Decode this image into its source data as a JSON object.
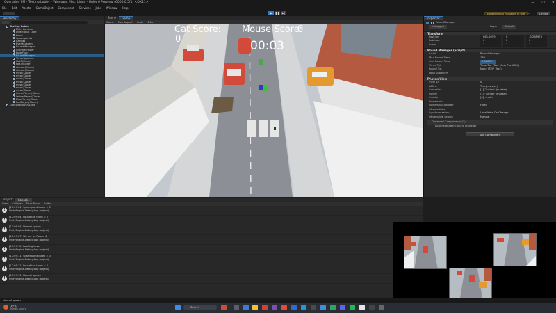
{
  "window": {
    "title": "Operation PM - Testing Lobby - Windows, Mac, Linux - Unity 6 Preview (6000.0.5f1) <DX11>",
    "min": "—",
    "max": "☐",
    "close": "✕"
  },
  "menu": [
    "File",
    "Edit",
    "Assets",
    "GameObject",
    "Component",
    "Services",
    "Jobs",
    "Window",
    "Help"
  ],
  "toolbar": {
    "package": "Experimental Packages In Use",
    "layout": "Layout"
  },
  "hierarchy": {
    "tab": "Hierarchy",
    "items": [
      {
        "label": "Testing Lobby",
        "bold": true
      },
      {
        "label": "Main Camera"
      },
      {
        "label": "Directional Light"
      },
      {
        "label": "Level"
      },
      {
        "label": "Spawnpoints"
      },
      {
        "label": "Canvas"
      },
      {
        "label": "EventSystem"
      },
      {
        "label": "RoundManager"
      },
      {
        "label": "ScoreManager"
      },
      {
        "label": "Fake Floor"
      },
      {
        "label": "RoundManager",
        "sel": true
      },
      {
        "label": "TimerSpawner"
      },
      {
        "label": "Hat3(Clone)"
      },
      {
        "label": "Hat3(Clone)"
      },
      {
        "label": "cheese(Clone)"
      },
      {
        "label": "cheese(Clone)"
      },
      {
        "label": "meat(Clone)"
      },
      {
        "label": "meat(Clone)"
      },
      {
        "label": "meat(Clone)"
      },
      {
        "label": "meat(Clone)"
      },
      {
        "label": "meat(Clone)"
      },
      {
        "label": "meat(Clone)"
      },
      {
        "label": "meat(Clone)"
      },
      {
        "label": "GreenPlayer(Clone)"
      },
      {
        "label": "YellowPlayer(Clone)"
      },
      {
        "label": "BluePlayer(Clone)"
      },
      {
        "label": "RedPlayer(Clone)"
      },
      {
        "label": "DontDestroyOnLoad"
      }
    ]
  },
  "scene_tabs": [
    {
      "label": "Scene"
    },
    {
      "label": "Game",
      "active": true
    }
  ],
  "game_bar": {
    "display": "Game",
    "aspect": "Free Aspect",
    "scale": "Scale",
    "scale_val": "1.1x"
  },
  "hud": {
    "cat_label": "Cat Score:",
    "cat_score": "0",
    "mouse_label": "Mouse Score:",
    "mouse_score": "0",
    "timer": "00:03"
  },
  "inspector": {
    "tab": "Inspector",
    "object": "RoundManager",
    "tag": "Untagged",
    "layer_label": "Layer",
    "layer": "Default",
    "transform": {
      "title": "Transform",
      "rows": [
        {
          "k": "Position",
          "x": "661.2059",
          "y": "0",
          "z": "-3.288973"
        },
        {
          "k": "Rotation",
          "x": "0",
          "y": "0",
          "z": "0"
        },
        {
          "k": "Scale",
          "x": "1",
          "y": "1",
          "z": "1"
        }
      ]
    },
    "round_manager": {
      "title": "Round Manager (Script)",
      "rows": [
        {
          "k": "Script",
          "v": "RoundManager"
        },
        {
          "k": "Max Round Time",
          "v": "180"
        },
        {
          "k": "Curr Round Time",
          "v": "3.338577"
        },
        {
          "k": "Timer Txt",
          "v": "TimerTxt (Text Mesh Pro UGUI)"
        },
        {
          "k": "Round Txt",
          "v": "None (TMP_Text)"
        },
        {
          "k": "Food Spawners",
          "v": ""
        }
      ]
    },
    "photon_view": {
      "title": "Photon View",
      "rows": [
        {
          "k": "View ID",
          "v": "0"
        },
        {
          "k": "IsMine",
          "v": "True (master)"
        },
        {
          "k": "Controller",
          "v": "[1] 'Tuchan' (master)"
        },
        {
          "k": "Owner",
          "v": "[1] 'Tuchan' (master)"
        },
        {
          "k": "Creator",
          "v": "[0] <null>"
        },
        {
          "k": "Ownership",
          "v": ""
        },
        {
          "k": "Ownership Transfer",
          "v": "Fixed"
        },
        {
          "k": "Observables",
          "v": ""
        },
        {
          "k": "Synchronization",
          "v": "Unreliable On Change"
        },
        {
          "k": "Observable Search",
          "v": "Manual"
        }
      ]
    },
    "observed": "Observed Components (1)",
    "observed_item": "RoundManager (Round Manager)",
    "add_component": "Add Component"
  },
  "console": {
    "tabs": [
      "Project",
      "Console"
    ],
    "buttons": [
      "Clear",
      "Collapse",
      "Error Pause",
      "Editor"
    ],
    "logs": [
      {
        "t": "[17:09:04] Spawnpoint index = 0",
        "s": "UnityEngine.Debug:Log (object)"
      },
      {
        "t": "[17:09:04] Found the team = 0",
        "s": "UnityEngine.Debug:Log (object)"
      },
      {
        "t": "[17:09:04] Normal spawn",
        "s": "UnityEngine.Debug:Log (object)"
      },
      {
        "t": "[17:09:07] We are on Round 4",
        "s": "UnityEngine.Debug:Log (object)"
      },
      {
        "t": "[17:09:10] Loading Level",
        "s": "UnityEngine.Debug:Log (object)"
      },
      {
        "t": "[17:09:11] Spawnpoint index = 0",
        "s": "UnityEngine.Debug:Log (object)"
      },
      {
        "t": "[17:09:11] Found the team = 0",
        "s": "UnityEngine.Debug:Log (object)"
      },
      {
        "t": "[17:09:11] Normal spawn",
        "s": "UnityEngine.Debug:Log (object)"
      }
    ]
  },
  "status": "Normal spawn",
  "taskbar": {
    "temp": "19°C",
    "weather": "Mostly sunny",
    "search": "Search"
  }
}
